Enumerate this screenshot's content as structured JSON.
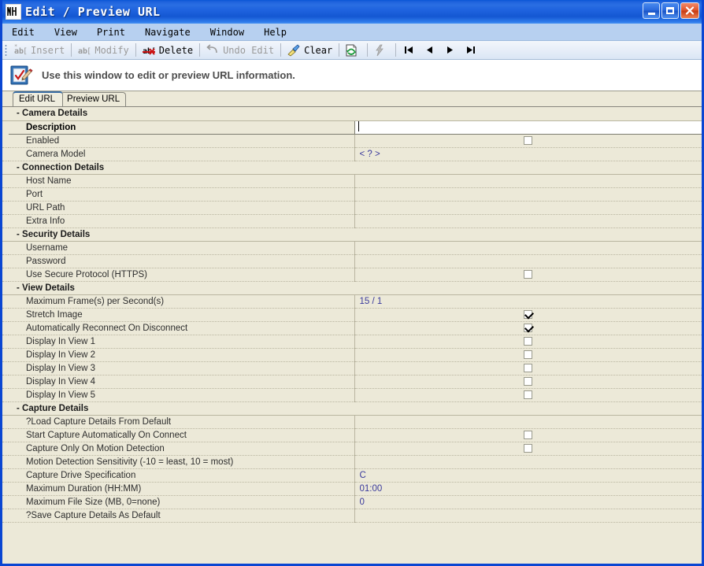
{
  "window": {
    "title": "Edit / Preview URL",
    "app_icon": "notepad-pencil-icon",
    "buttons": {
      "minimize": "minimize-button",
      "maximize": "maximize-button",
      "close": "close-button"
    }
  },
  "menu": {
    "items": [
      "Edit",
      "View",
      "Print",
      "Navigate",
      "Window",
      "Help"
    ]
  },
  "toolbar": {
    "items": [
      {
        "label": "Insert",
        "icon": "insert-abc-icon",
        "disabled": true
      },
      {
        "label": "Modify",
        "icon": "modify-abc-icon",
        "disabled": true
      },
      {
        "label": "Delete",
        "icon": "delete-abc-icon",
        "disabled": false
      },
      {
        "label": "Undo Edit",
        "icon": "undo-arrow-icon",
        "disabled": true
      },
      {
        "label": "Clear",
        "icon": "clear-brush-icon",
        "disabled": false
      }
    ],
    "icon_buttons": [
      {
        "name": "refresh-page-icon",
        "disabled": false
      },
      {
        "name": "lightning-icon",
        "disabled": true
      }
    ],
    "nav_buttons": [
      {
        "name": "first-record-icon",
        "glyph": "|<"
      },
      {
        "name": "previous-record-icon",
        "glyph": "<"
      },
      {
        "name": "next-record-icon",
        "glyph": ">"
      },
      {
        "name": "last-record-icon",
        "glyph": ">|"
      }
    ]
  },
  "infobar": {
    "icon": "edit-preview-icon",
    "text": "Use this window to edit or preview URL information."
  },
  "tabs": [
    {
      "label": "Edit URL",
      "active": true
    },
    {
      "label": "Preview URL",
      "active": false
    }
  ],
  "grid": {
    "sections": [
      {
        "name": "camera-details",
        "title": "- Camera Details",
        "rows": [
          {
            "label": "Description",
            "value": "",
            "type": "text",
            "selected": true
          },
          {
            "label": "Enabled",
            "value": "",
            "type": "checkbox",
            "checked": false
          },
          {
            "label": "Camera Model",
            "value": "< ? >",
            "type": "text"
          }
        ]
      },
      {
        "name": "connection-details",
        "title": "- Connection Details",
        "rows": [
          {
            "label": "Host Name",
            "value": "",
            "type": "text"
          },
          {
            "label": "Port",
            "value": "",
            "type": "text"
          },
          {
            "label": "URL Path",
            "value": "",
            "type": "text"
          },
          {
            "label": "Extra Info",
            "value": "",
            "type": "text"
          }
        ]
      },
      {
        "name": "security-details",
        "title": "- Security Details",
        "rows": [
          {
            "label": "Username",
            "value": "",
            "type": "text"
          },
          {
            "label": "Password",
            "value": "",
            "type": "text"
          },
          {
            "label": "Use Secure Protocol (HTTPS)",
            "value": "",
            "type": "checkbox",
            "checked": false
          }
        ]
      },
      {
        "name": "view-details",
        "title": "- View Details",
        "rows": [
          {
            "label": "Maximum Frame(s) per Second(s)",
            "value": "15 / 1",
            "type": "text"
          },
          {
            "label": "Stretch Image",
            "value": "",
            "type": "checkbox",
            "checked": true
          },
          {
            "label": "Automatically Reconnect On Disconnect",
            "value": "",
            "type": "checkbox",
            "checked": true
          },
          {
            "label": "Display In View 1",
            "value": "",
            "type": "checkbox",
            "checked": false
          },
          {
            "label": "Display In View 2",
            "value": "",
            "type": "checkbox",
            "checked": false
          },
          {
            "label": "Display In View 3",
            "value": "",
            "type": "checkbox",
            "checked": false
          },
          {
            "label": "Display In View 4",
            "value": "",
            "type": "checkbox",
            "checked": false
          },
          {
            "label": "Display In View 5",
            "value": "",
            "type": "checkbox",
            "checked": false
          }
        ]
      },
      {
        "name": "capture-details",
        "title": "- Capture Details",
        "rows": [
          {
            "label": "?Load Capture Details From Default",
            "value": "",
            "type": "text"
          },
          {
            "label": "Start Capture Automatically On Connect",
            "value": "",
            "type": "checkbox",
            "checked": false
          },
          {
            "label": "Capture Only On Motion Detection",
            "value": "",
            "type": "checkbox",
            "checked": false
          },
          {
            "label": "Motion Detection Sensitivity (-10 = least, 10 = most)",
            "value": "",
            "type": "text"
          },
          {
            "label": "Capture Drive Specification",
            "value": "C",
            "type": "text"
          },
          {
            "label": "Maximum Duration (HH:MM)",
            "value": "01:00",
            "type": "text"
          },
          {
            "label": "Maximum File Size (MB, 0=none)",
            "value": "0",
            "type": "text"
          },
          {
            "label": "?Save Capture Details As Default",
            "value": "",
            "type": "text"
          }
        ]
      }
    ]
  },
  "colors": {
    "titlebar": "#1e62de",
    "window_face": "#ece9d8",
    "value_text": "#3a3a9c",
    "grid_line": "#b9b5a0",
    "close_button": "#d1411c"
  }
}
